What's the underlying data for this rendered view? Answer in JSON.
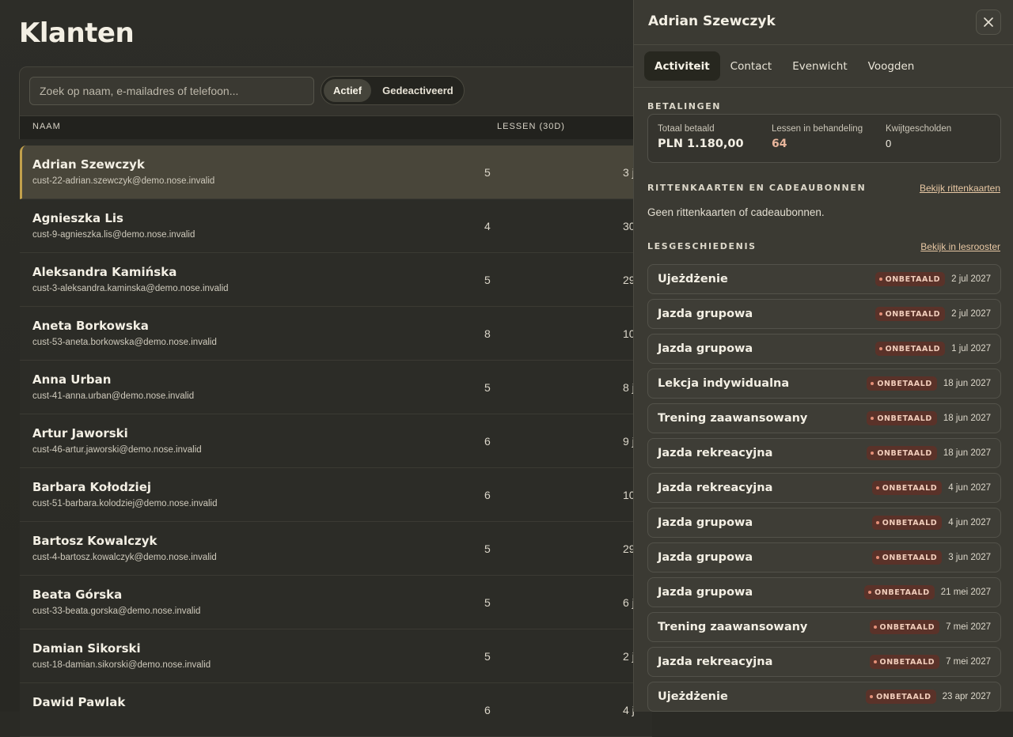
{
  "page": {
    "title": "Klanten"
  },
  "search": {
    "placeholder": "Zoek op naam, e-mailadres of telefoon..."
  },
  "filter": {
    "options": [
      "Actief",
      "Gedeactiveerd"
    ],
    "selected": "Actief"
  },
  "table": {
    "columns": [
      "NAAM",
      "LESSEN (30D)"
    ],
    "rows": [
      {
        "name": "Adrian Szewczyk",
        "email": "cust-22-adrian.szewczyk@demo.nose.invalid",
        "lessons": "5",
        "last": "3 j"
      },
      {
        "name": "Agnieszka Lis",
        "email": "cust-9-agnieszka.lis@demo.nose.invalid",
        "lessons": "4",
        "last": "30"
      },
      {
        "name": "Aleksandra Kamińska",
        "email": "cust-3-aleksandra.kaminska@demo.nose.invalid",
        "lessons": "5",
        "last": "29"
      },
      {
        "name": "Aneta Borkowska",
        "email": "cust-53-aneta.borkowska@demo.nose.invalid",
        "lessons": "8",
        "last": "10"
      },
      {
        "name": "Anna Urban",
        "email": "cust-41-anna.urban@demo.nose.invalid",
        "lessons": "5",
        "last": "8 j"
      },
      {
        "name": "Artur Jaworski",
        "email": "cust-46-artur.jaworski@demo.nose.invalid",
        "lessons": "6",
        "last": "9 j"
      },
      {
        "name": "Barbara Kołodziej",
        "email": "cust-51-barbara.kolodziej@demo.nose.invalid",
        "lessons": "6",
        "last": "10"
      },
      {
        "name": "Bartosz Kowalczyk",
        "email": "cust-4-bartosz.kowalczyk@demo.nose.invalid",
        "lessons": "5",
        "last": "29"
      },
      {
        "name": "Beata Górska",
        "email": "cust-33-beata.gorska@demo.nose.invalid",
        "lessons": "5",
        "last": "6 j"
      },
      {
        "name": "Damian Sikorski",
        "email": "cust-18-damian.sikorski@demo.nose.invalid",
        "lessons": "5",
        "last": "2 j"
      },
      {
        "name": "Dawid Pawlak",
        "email": "",
        "lessons": "6",
        "last": "4 j"
      }
    ]
  },
  "drawer": {
    "title": "Adrian Szewczyk",
    "close_icon": "close-icon",
    "tabs": [
      "Activiteit",
      "Contact",
      "Evenwicht",
      "Voogden"
    ],
    "active_tab": "Activiteit",
    "payments": {
      "heading": "BETALINGEN",
      "total_label": "Totaal betaald",
      "total_value": "PLN 1.180,00",
      "pending_label": "Lessen in behandeling",
      "pending_value": "64",
      "waived_label": "Kwijtgescholden",
      "waived_value": "0"
    },
    "passes": {
      "heading": "RITTENKAARTEN EN CADEAUBONNEN",
      "link": "Bekijk rittenkaarten",
      "empty": "Geen rittenkaarten of cadeaubonnen."
    },
    "history": {
      "heading": "LESGESCHIEDENIS",
      "link": "Bekijk in lesrooster",
      "items": [
        {
          "name": "Ujeżdżenie",
          "status": "ONBETAALD",
          "date": "2 jul 2027"
        },
        {
          "name": "Jazda grupowa",
          "status": "ONBETAALD",
          "date": "2 jul 2027"
        },
        {
          "name": "Jazda grupowa",
          "status": "ONBETAALD",
          "date": "1 jul 2027"
        },
        {
          "name": "Lekcja indywidualna",
          "status": "ONBETAALD",
          "date": "18 jun 2027"
        },
        {
          "name": "Trening zaawansowany",
          "status": "ONBETAALD",
          "date": "18 jun 2027"
        },
        {
          "name": "Jazda rekreacyjna",
          "status": "ONBETAALD",
          "date": "18 jun 2027"
        },
        {
          "name": "Jazda rekreacyjna",
          "status": "ONBETAALD",
          "date": "4 jun 2027"
        },
        {
          "name": "Jazda grupowa",
          "status": "ONBETAALD",
          "date": "4 jun 2027"
        },
        {
          "name": "Jazda grupowa",
          "status": "ONBETAALD",
          "date": "3 jun 2027"
        },
        {
          "name": "Jazda grupowa",
          "status": "ONBETAALD",
          "date": "21 mei 2027"
        },
        {
          "name": "Trening zaawansowany",
          "status": "ONBETAALD",
          "date": "7 mei 2027"
        },
        {
          "name": "Jazda rekreacyjna",
          "status": "ONBETAALD",
          "date": "7 mei 2027"
        },
        {
          "name": "Ujeżdżenie",
          "status": "ONBETAALD",
          "date": "23 apr 2027"
        }
      ]
    }
  },
  "colors": {
    "accent": "#c2a14c",
    "unpaid_badge": "#5a3229",
    "link": "#e8c8a4"
  }
}
